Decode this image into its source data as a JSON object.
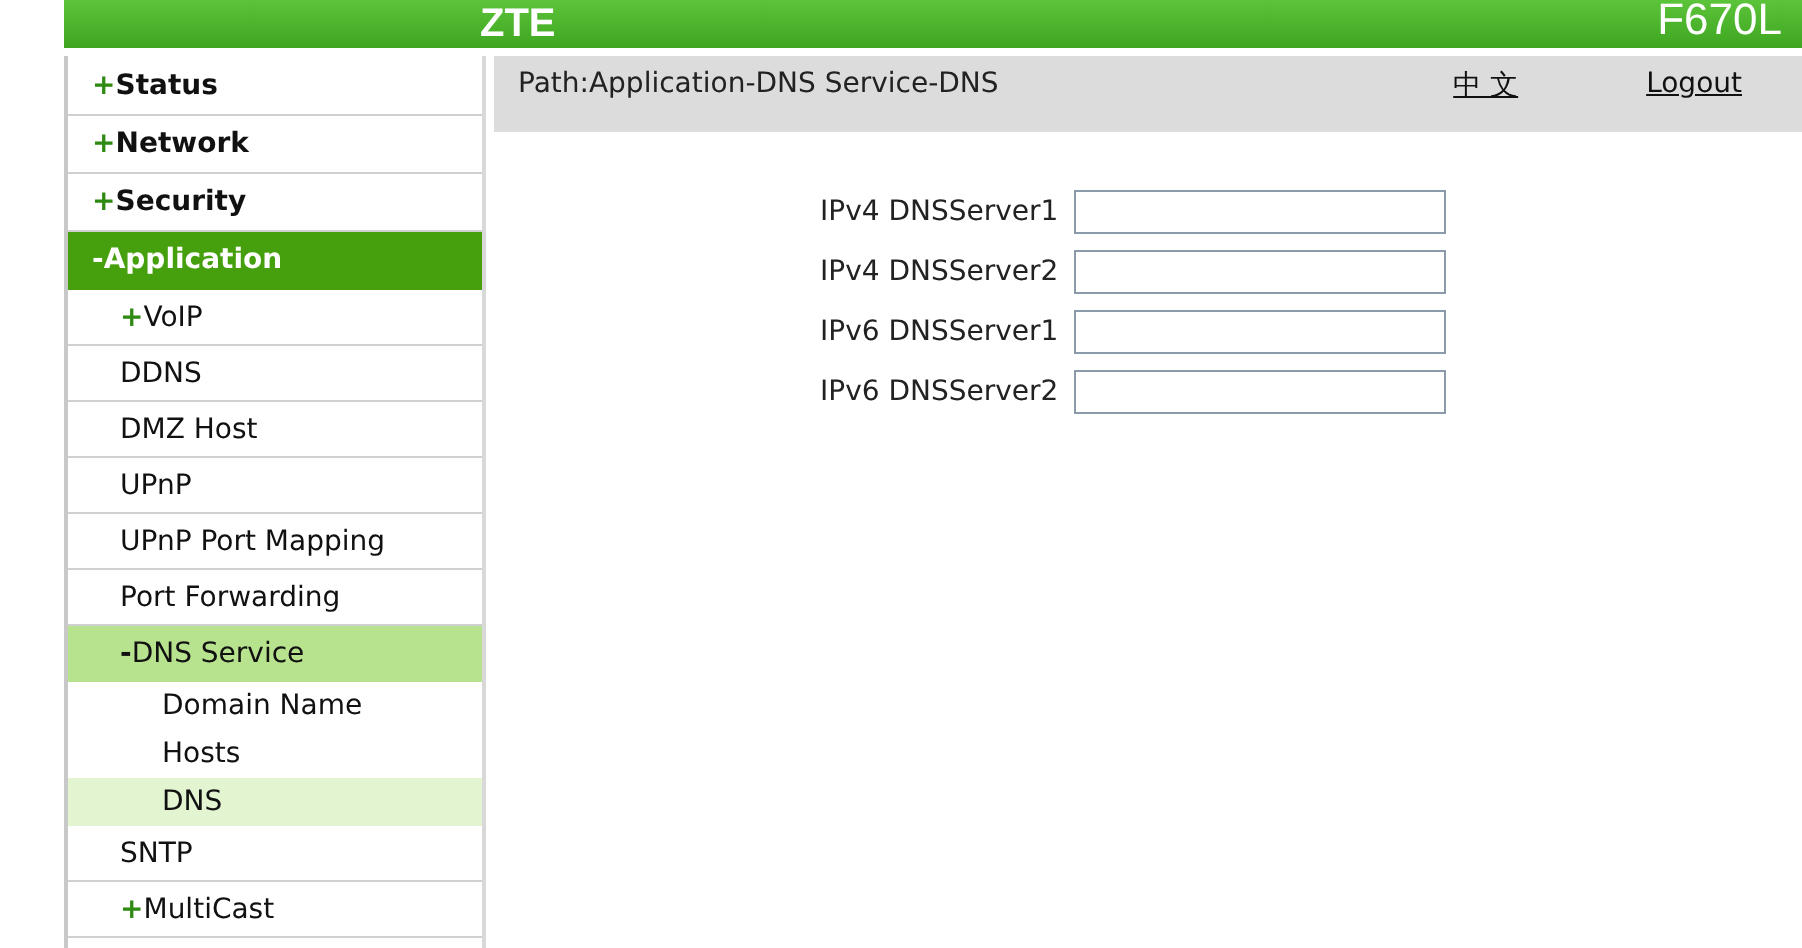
{
  "header": {
    "logo": "ZTE",
    "model": "F670L"
  },
  "sidebar": {
    "items": [
      {
        "marker": "+",
        "label": "Status",
        "expanded": false
      },
      {
        "marker": "+",
        "label": "Network",
        "expanded": false
      },
      {
        "marker": "+",
        "label": "Security",
        "expanded": false
      },
      {
        "marker": "-",
        "label": "Application",
        "expanded": true,
        "children": [
          {
            "marker": "+",
            "label": "VoIP",
            "expanded": false
          },
          {
            "label": "DDNS",
            "selected": false
          },
          {
            "label": "DMZ Host",
            "selected": false
          },
          {
            "label": "UPnP",
            "selected": false
          },
          {
            "label": "UPnP Port Mapping",
            "selected": false
          },
          {
            "label": "Port Forwarding",
            "selected": false
          },
          {
            "marker": "-",
            "label": "DNS Service",
            "expanded": true,
            "children": [
              {
                "label": "Domain Name",
                "selected": false
              },
              {
                "label": "Hosts",
                "selected": false
              },
              {
                "label": "DNS",
                "selected": true
              }
            ]
          },
          {
            "label": "SNTP",
            "selected": false
          },
          {
            "marker": "+",
            "label": "MultiCast",
            "expanded": false
          }
        ]
      }
    ]
  },
  "path_bar": {
    "path": "Path:Application-DNS Service-DNS",
    "language": "中 文",
    "logout": "Logout"
  },
  "form": {
    "fields": [
      {
        "label": "IPv4 DNSServer1"
      },
      {
        "label": "IPv4 DNSServer2"
      },
      {
        "label": "IPv6 DNSServer1"
      },
      {
        "label": "IPv6 DNSServer2"
      }
    ]
  }
}
